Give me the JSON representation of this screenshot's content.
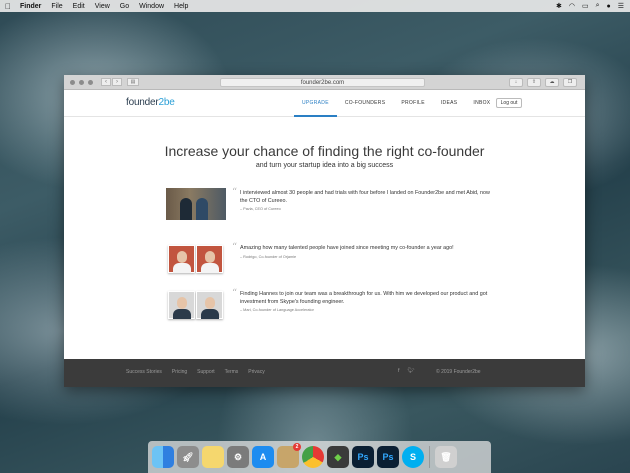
{
  "menubar": {
    "items": [
      "Finder",
      "File",
      "Edit",
      "View",
      "Go",
      "Window",
      "Help"
    ]
  },
  "browser": {
    "url": "founder2be.com"
  },
  "site": {
    "logo_main": "founder",
    "logo_accent": "2be",
    "nav": [
      "UPGRADE",
      "CO-FOUNDERS",
      "PROFILE",
      "IDEAS",
      "INBOX"
    ],
    "active_nav": "UPGRADE",
    "logout_label": "Log out"
  },
  "hero": {
    "title": "Increase your chance of finding the right co-founder",
    "subtitle": "and turn your startup idea into a big success"
  },
  "testimonials": [
    {
      "text": "I interviewed almost 30 people and had trials with four before I landed on Founder2be and met Abid, now the CTO of Cureeo.",
      "author": "– Pavla, CEO of Cureeo"
    },
    {
      "text": "Amazing how many talented people have joined since meeting my co-founder a year ago!",
      "author": "– Rodrigo, Co-founder of Orjamie"
    },
    {
      "text": "Finding Hannes to join our team was a breakthrough for us. With him we developed our product and got investment from Skype's founding engineer.",
      "author": "– Mari, Co-founder of Language Accelerator"
    }
  ],
  "footer": {
    "links": [
      "Success Stories",
      "Pricing",
      "Support",
      "Terms",
      "Privacy"
    ],
    "copyright": "© 2019 Founder2be"
  },
  "colors": {
    "accent": "#2a7fc4",
    "footer_bg": "#3b3b3b"
  },
  "dock": {
    "apps": [
      {
        "name": "finder-icon",
        "color": "#3d8ee6"
      },
      {
        "name": "launchpad-icon",
        "color": "#8a8a8a"
      },
      {
        "name": "notes-icon",
        "color": "#f5d76e"
      },
      {
        "name": "system-preferences-icon",
        "color": "#7b7b7b"
      },
      {
        "name": "app-store-icon",
        "color": "#1d8cf0"
      },
      {
        "name": "preview-icon",
        "color": "#c7a56a",
        "badge": "2"
      },
      {
        "name": "chrome-icon",
        "color": "#e8e8e8"
      },
      {
        "name": "evernote-icon",
        "color": "#3a3a3a"
      },
      {
        "name": "photoshop-icon",
        "color": "#0b1f33",
        "label": "Ps"
      },
      {
        "name": "photoshop-icon",
        "color": "#0b1f33",
        "label": "Ps"
      },
      {
        "name": "skype-icon",
        "color": "#00aff0",
        "label": "S"
      },
      {
        "name": "trash-icon",
        "color": "#d0d0d0"
      }
    ]
  }
}
